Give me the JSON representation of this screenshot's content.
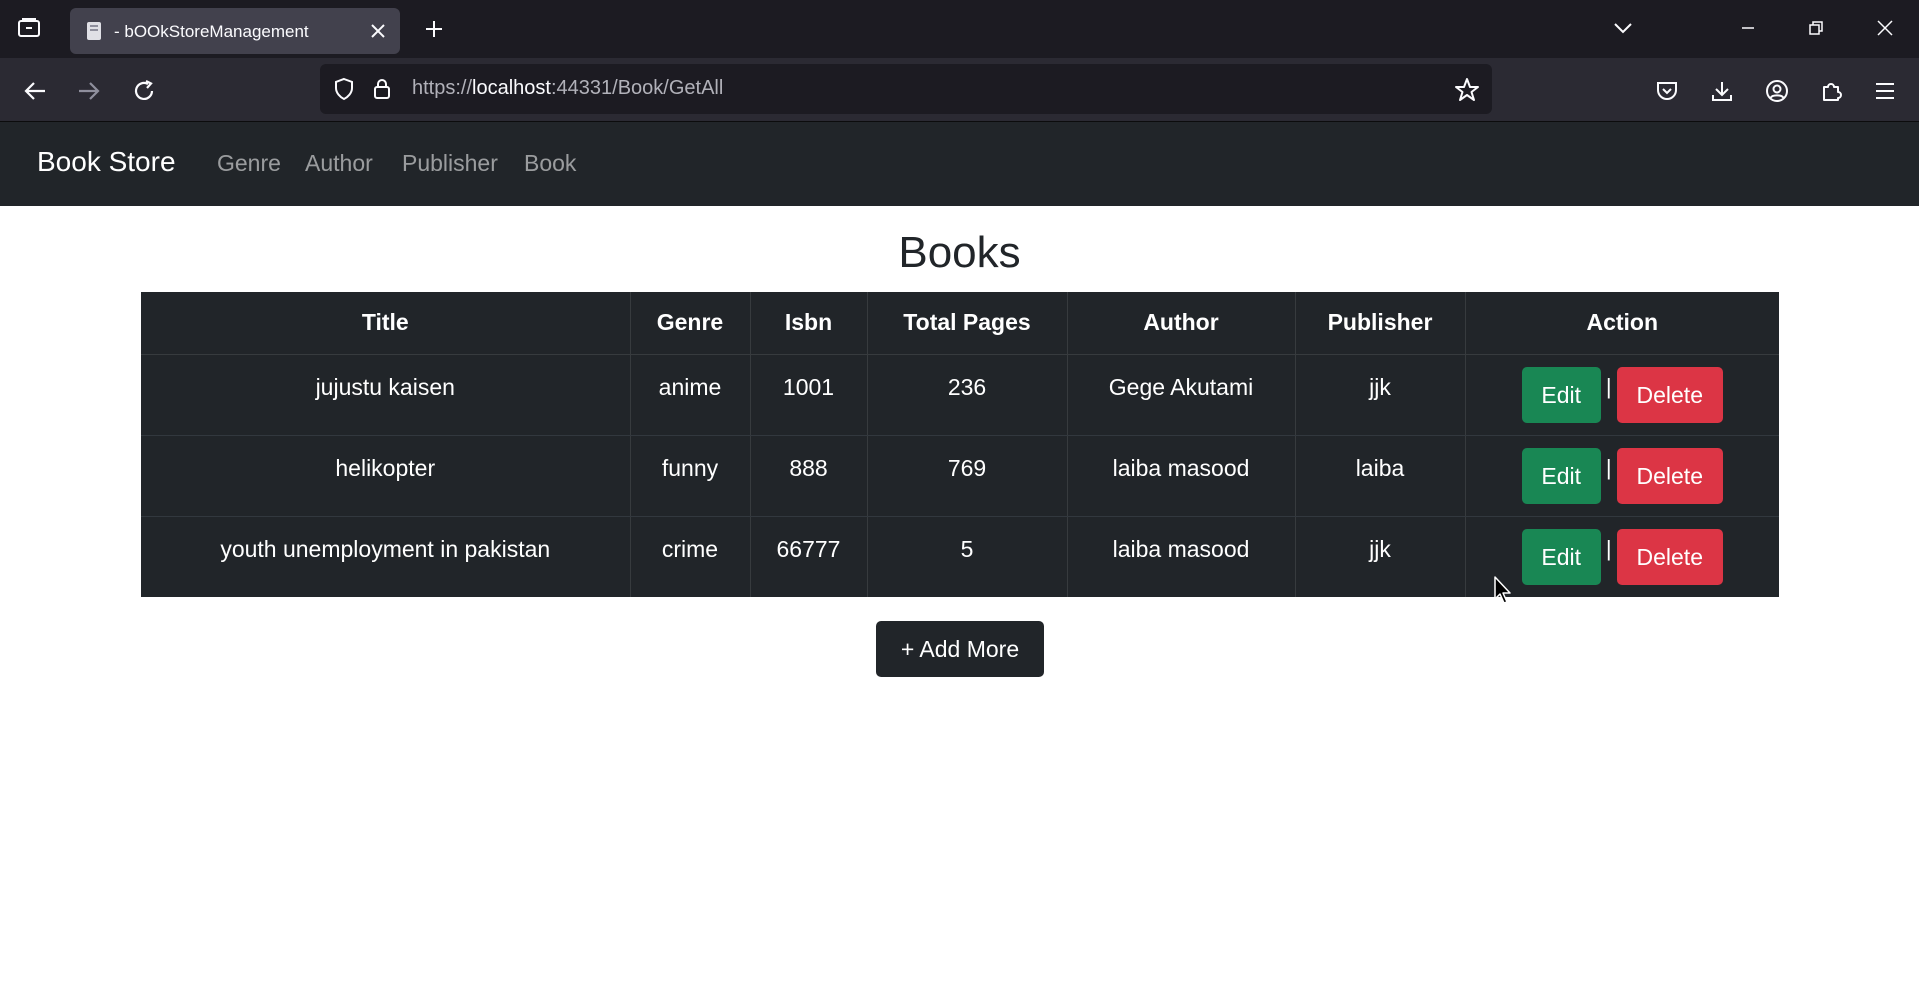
{
  "browser": {
    "tab_title": "- bOOkStoreManagement",
    "url_prefix": "https://",
    "url_host": "localhost",
    "url_rest": ":44331/Book/GetAll"
  },
  "site": {
    "brand": "Book Store",
    "nav": [
      "Genre",
      "Author",
      "Publisher",
      "Book"
    ]
  },
  "page": {
    "title": "Books",
    "add_more_label": "+ Add More"
  },
  "table": {
    "headers": [
      "Title",
      "Genre",
      "Isbn",
      "Total Pages",
      "Author",
      "Publisher",
      "Action"
    ],
    "rows": [
      [
        "jujustu kaisen",
        "anime",
        "1001",
        "236",
        "Gege Akutami",
        "jjk"
      ],
      [
        "helikopter",
        "funny",
        "888",
        "769",
        "laiba masood",
        "laiba"
      ],
      [
        "youth unemployment in pakistan",
        "crime",
        "66777",
        "5",
        "laiba masood",
        "jjk"
      ]
    ],
    "edit_label": "Edit",
    "delete_label": "Delete",
    "separator": "|"
  },
  "colors": {
    "edit": "#198754",
    "delete": "#dc3545",
    "dark": "#212529"
  }
}
